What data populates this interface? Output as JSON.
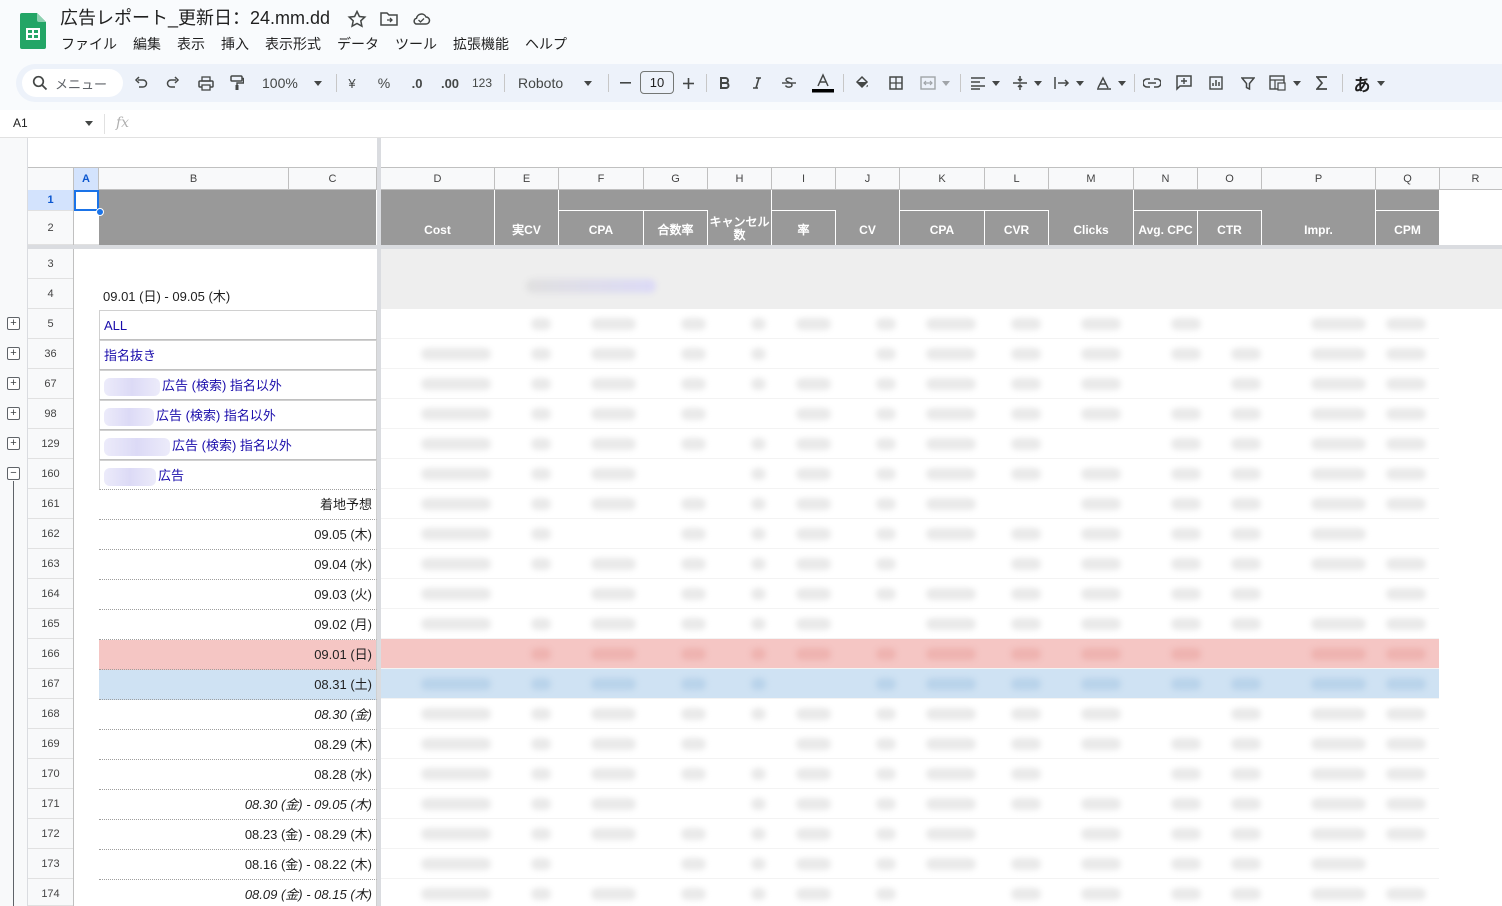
{
  "title": "広告レポート_更新日：24.mm.dd",
  "menu": [
    "ファイル",
    "編集",
    "表示",
    "挿入",
    "表示形式",
    "データ",
    "ツール",
    "拡張機能",
    "ヘルプ"
  ],
  "toolbar": {
    "search_label": "メニュー",
    "zoom": "100%",
    "currency": "¥",
    "percent": "%",
    "decrease_decimal": ".0",
    "increase_decimal": ".00",
    "format_123": "123",
    "font": "Roboto",
    "font_size": "10",
    "input_tools": "あ"
  },
  "namebox": "A1",
  "fx": "fx",
  "columns": [
    "A",
    "B",
    "C",
    "D",
    "E",
    "F",
    "G",
    "H",
    "I",
    "J",
    "K",
    "L",
    "M",
    "N",
    "O",
    "P",
    "Q",
    "R"
  ],
  "header": {
    "cost": "Cost",
    "real_cv": "実CV",
    "cpa": "CPA",
    "close_rate": "合数率",
    "cancel": "キャンセル数",
    "rate": "率",
    "cv": "CV",
    "cpa2": "CPA",
    "cvr": "CVR",
    "clicks": "Clicks",
    "avg_cpc": "Avg. CPC",
    "ctr": "CTR",
    "impr": "Impr.",
    "cpm": "CPM"
  },
  "date_range": "09.01 (日) - 09.05 (木)",
  "group_rows": [
    {
      "num": "5",
      "label": "ALL"
    },
    {
      "num": "36",
      "label": "指名抜き"
    },
    {
      "num": "67",
      "label": "広告 (検索) 指名以外"
    },
    {
      "num": "98",
      "label": "広告 (検索) 指名以外"
    },
    {
      "num": "129",
      "label": "広告 (検索) 指名以外"
    },
    {
      "num": "160",
      "label": "広告"
    }
  ],
  "detail_rows": [
    {
      "num": "161",
      "label": "着地予想"
    },
    {
      "num": "162",
      "label": "09.05 (木)"
    },
    {
      "num": "163",
      "label": "09.04 (水)"
    },
    {
      "num": "164",
      "label": "09.03 (火)"
    },
    {
      "num": "165",
      "label": "09.02 (月)"
    },
    {
      "num": "166",
      "label": "09.01 (日)"
    },
    {
      "num": "167",
      "label": "08.31 (土)"
    },
    {
      "num": "168",
      "label": "08.30 (金)"
    },
    {
      "num": "169",
      "label": "08.29 (木)"
    },
    {
      "num": "170",
      "label": "08.28 (水)"
    },
    {
      "num": "171",
      "label": "08.30 (金) - 09.05 (木)"
    },
    {
      "num": "172",
      "label": "08.23 (金) - 08.29 (木)"
    },
    {
      "num": "173",
      "label": "08.16 (金) - 08.22 (木)"
    },
    {
      "num": "174",
      "label": "08.09 (金) - 08.15 (木)"
    }
  ],
  "row_nums_top": [
    "1",
    "2",
    "3",
    "4"
  ]
}
